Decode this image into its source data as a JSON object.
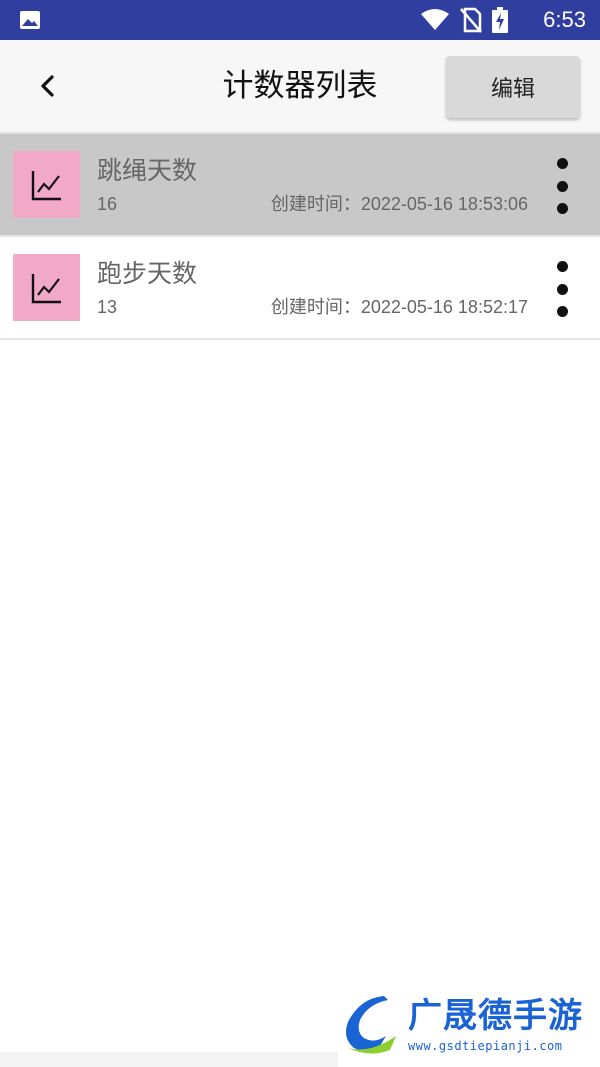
{
  "status_bar": {
    "time": "6:53",
    "background": "#303F9F",
    "icons": [
      "gallery-icon",
      "wifi-icon",
      "no-sim-icon",
      "battery-charging-icon"
    ]
  },
  "app_bar": {
    "title": "计数器列表",
    "back_icon": "chevron-left-icon",
    "edit_label": "编辑"
  },
  "counters": [
    {
      "name": "跳绳天数",
      "count": "16",
      "created": "创建时间：2022-05-16 18:53:06",
      "selected": true,
      "icon": "line-chart-icon"
    },
    {
      "name": "跑步天数",
      "count": "13",
      "created": "创建时间：2022-05-16 18:52:17",
      "selected": false,
      "icon": "line-chart-icon"
    }
  ],
  "colors": {
    "thumb_bg": "#f2a9c8",
    "selected_row": "#c8c8c8",
    "watermark_blue": "#1a63d4"
  },
  "watermark": {
    "title": "广晟德手游",
    "url": "www.gsdtiepianji.com"
  }
}
